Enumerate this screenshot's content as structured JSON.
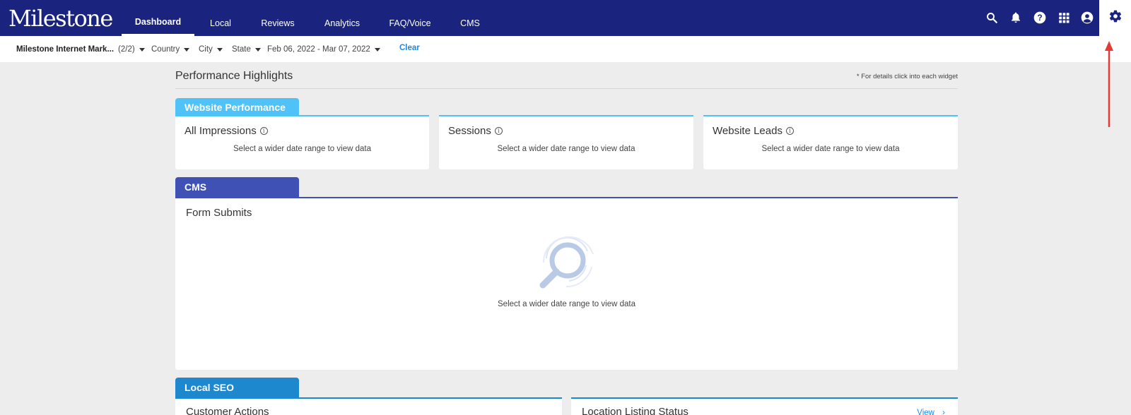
{
  "header": {
    "logo": "Milestone",
    "tabs": [
      {
        "label": "Dashboard",
        "active": true
      },
      {
        "label": "Local"
      },
      {
        "label": "Reviews"
      },
      {
        "label": "Analytics"
      },
      {
        "label": "FAQ/Voice"
      },
      {
        "label": "CMS"
      }
    ],
    "icons": [
      "search-icon",
      "bell-icon",
      "help-icon",
      "apps-icon",
      "account-icon",
      "gear-icon"
    ]
  },
  "filters": {
    "account": "Milestone Internet Mark...",
    "account_count": "(2/2)",
    "country": "Country",
    "city": "City",
    "state": "State",
    "date_range": "Feb 06, 2022 - Mar 07, 2022",
    "clear": "Clear"
  },
  "main": {
    "title": "Performance Highlights",
    "hint": "* For details click into each widget",
    "website_performance": {
      "tab": "Website Performance",
      "cards": [
        {
          "title": "All Impressions",
          "message": "Select a wider date range to view data"
        },
        {
          "title": "Sessions",
          "message": "Select a wider date range to view data"
        },
        {
          "title": "Website Leads",
          "message": "Select a wider date range to view data"
        }
      ]
    },
    "cms": {
      "tab": "CMS",
      "card": {
        "title": "Form Submits",
        "message": "Select a wider date range to view data"
      }
    },
    "local_seo": {
      "tab": "Local SEO",
      "cards": [
        {
          "title": "Customer Actions"
        },
        {
          "title": "Location Listing Status",
          "link": "View"
        }
      ]
    }
  },
  "colors": {
    "topbar": "#1a237e",
    "website_performance": "#4fc3f7",
    "cms": "#3f51b5",
    "local_seo": "#1e88cf",
    "annotation_arrow": "#e53935"
  }
}
